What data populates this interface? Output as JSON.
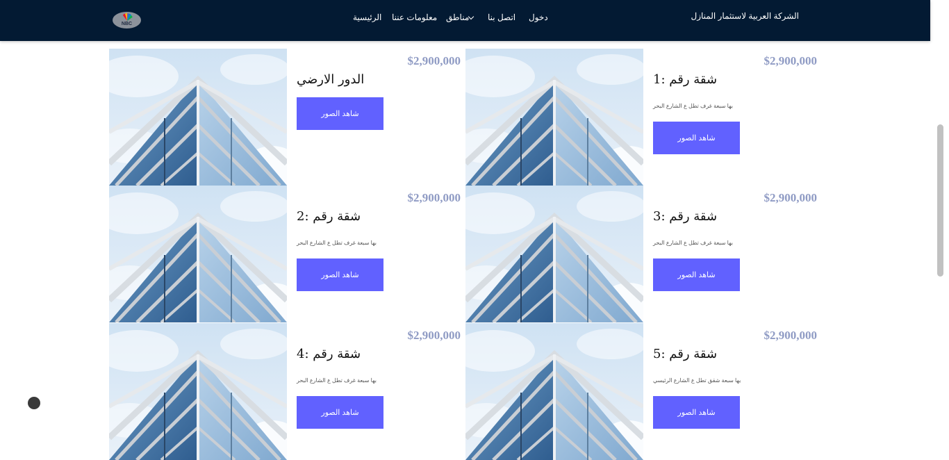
{
  "navbar": {
    "brand": "الشركة العربية لاستثمار المنازل",
    "links": [
      "الرئيسية",
      "معلومات عننا",
      "مناطق",
      "اتصل بنا",
      "دخول"
    ],
    "logo_text": "NBC",
    "background": "#031a33"
  },
  "listings": [
    {
      "price": "$2,900,000",
      "title": "الدور الارضي",
      "description": "",
      "button": "شاهد الصور"
    },
    {
      "price": "$2,900,000",
      "title": "شقة رقم :1",
      "description": "بها سبعة غرف تطل ع الشارع البحر",
      "button": "شاهد الصور"
    },
    {
      "price": "$2,900,000",
      "title": "شقة رقم :2",
      "description": "بها سبعة غرف تطل ع الشارع البحر",
      "button": "شاهد الصور"
    },
    {
      "price": "$2,900,000",
      "title": "شقة رقم :3",
      "description": "بها سبعة غرف تطل ع الشارع البحر",
      "button": "شاهد الصور"
    },
    {
      "price": "$2,900,000",
      "title": "شقة رقم :4",
      "description": "بها سبعة غرف تطل ع الشارع البحر",
      "button": "شاهد الصور"
    },
    {
      "price": "$2,900,000",
      "title": "شقة رقم :5",
      "description": "بها سبعة شقق تطل ع الشارع الرئيسي",
      "button": "شاهد الصور"
    }
  ],
  "colors": {
    "accent": "#6161ff",
    "price": "#8f9bc4"
  }
}
